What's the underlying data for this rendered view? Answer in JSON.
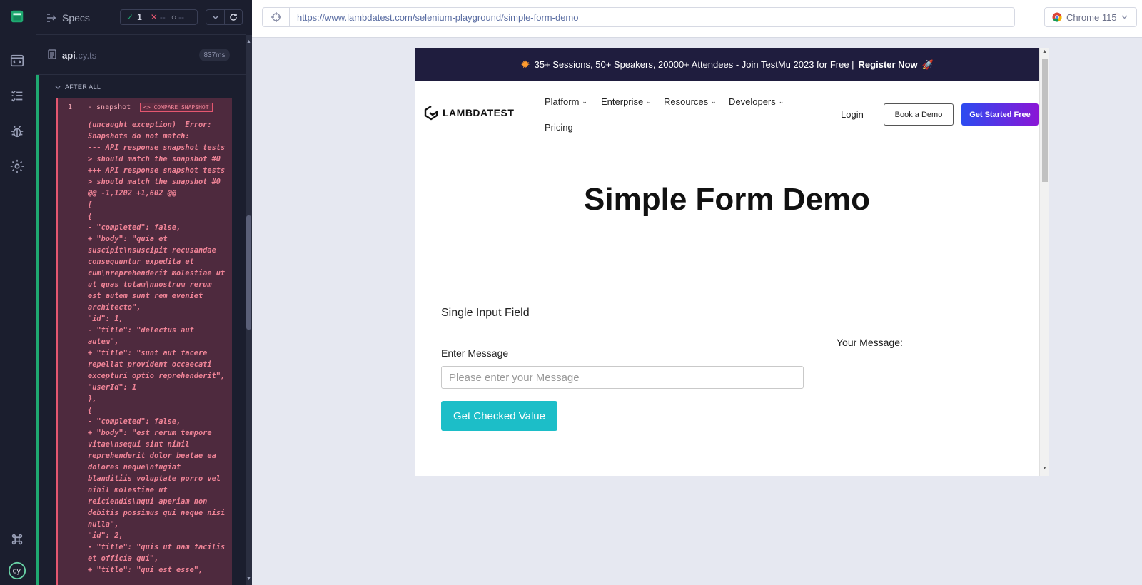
{
  "reporter": {
    "specs_label": "Specs",
    "stats": {
      "passed": "1",
      "failed": "--",
      "pending": "--"
    },
    "spec": {
      "name": "api",
      "ext": ".cy.ts",
      "duration": "837ms"
    },
    "hook_title": "AFTER ALL",
    "command": {
      "number": "1",
      "name": "- snapshot",
      "badge": "<> COMPARE SNAPSHOT"
    },
    "error_lines": [
      "(uncaught exception)  Error:",
      "Snapshots do not match:",
      "--- API response snapshot tests",
      "> should match the snapshot #0",
      "+++ API response snapshot tests",
      "> should match the snapshot #0",
      "@@ -1,1202 +1,602 @@",
      "[",
      "{",
      "- \"completed\": false,",
      "+ \"body\": \"quia et",
      "suscipit\\nsuscipit recusandae",
      "consequuntur expedita et",
      "cum\\nreprehenderit molestiae ut",
      "ut quas totam\\nnostrum rerum",
      "est autem sunt rem eveniet",
      "architecto\",",
      "\"id\": 1,",
      "- \"title\": \"delectus aut",
      "autem\",",
      "+ \"title\": \"sunt aut facere",
      "repellat provident occaecati",
      "excepturi optio reprehenderit\",",
      "\"userId\": 1",
      "},",
      "{",
      "- \"completed\": false,",
      "+ \"body\": \"est rerum tempore",
      "vitae\\nsequi sint nihil",
      "reprehenderit dolor beatae ea",
      "dolores neque\\nfugiat",
      "blanditiis voluptate porro vel",
      "nihil molestiae ut",
      "reiciendis\\nqui aperiam non",
      "debitis possimus qui neque nisi",
      "nulla\",",
      "\"id\": 2,",
      "- \"title\": \"quis ut nam facilis",
      "et officia qui\",",
      "+ \"title\": \"qui est esse\","
    ]
  },
  "browser": {
    "url": "https://www.lambdatest.com/selenium-playground/simple-form-demo",
    "name": "Chrome 115"
  },
  "site": {
    "banner_text": "35+ Sessions, 50+ Speakers, 20000+ Attendees - Join TestMu 2023 for Free |",
    "banner_cta": "Register Now",
    "logo": "LAMBDATEST",
    "nav": {
      "platform": "Platform",
      "enterprise": "Enterprise",
      "resources": "Resources",
      "developers": "Developers",
      "pricing": "Pricing"
    },
    "login": "Login",
    "book_demo": "Book a Demo",
    "get_started": "Get Started Free",
    "heading": "Simple Form Demo",
    "section_title": "Single Input Field",
    "your_message": "Your Message:",
    "enter_message": "Enter Message",
    "input_placeholder": "Please enter your Message",
    "button": "Get Checked Value"
  },
  "colors": {
    "reporter_bg": "#1b1e2e",
    "pass": "#1fa971",
    "fail": "#e45770",
    "banner_bg": "#1f1d3e",
    "primary_button": "#1cbec8"
  }
}
